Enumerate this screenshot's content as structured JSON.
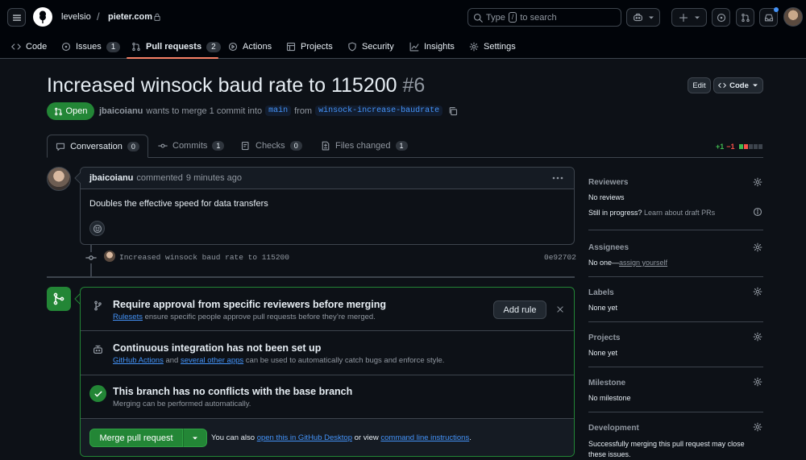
{
  "header": {
    "owner": "levelsio",
    "repo": "pieter.com",
    "search_prefix": "Type",
    "search_key": "/",
    "search_suffix": "to search"
  },
  "repo_tabs": [
    {
      "label": "Code",
      "count": ""
    },
    {
      "label": "Issues",
      "count": "1"
    },
    {
      "label": "Pull requests",
      "count": "2"
    },
    {
      "label": "Actions",
      "count": ""
    },
    {
      "label": "Projects",
      "count": ""
    },
    {
      "label": "Security",
      "count": ""
    },
    {
      "label": "Insights",
      "count": ""
    },
    {
      "label": "Settings",
      "count": ""
    }
  ],
  "pr": {
    "title": "Increased winsock baud rate to 115200",
    "number": "#6",
    "state": "Open",
    "author": "jbaicoianu",
    "merge_text": "wants to merge 1 commit into",
    "base_branch": "main",
    "from_text": "from",
    "head_branch": "winsock-increase-baudrate",
    "edit_label": "Edit",
    "code_label": "Code"
  },
  "pr_tabs": [
    {
      "label": "Conversation",
      "count": "0"
    },
    {
      "label": "Commits",
      "count": "1"
    },
    {
      "label": "Checks",
      "count": "0"
    },
    {
      "label": "Files changed",
      "count": "1"
    }
  ],
  "diffstat": {
    "added": "+1",
    "removed": "−1"
  },
  "comment": {
    "author": "jbaicoianu",
    "action": "commented",
    "time": "9 minutes ago",
    "body": "Doubles the effective speed for data transfers"
  },
  "commit": {
    "message": "Increased winsock baud rate to 115200",
    "sha": "0e92702"
  },
  "merge_box": {
    "approval_title": "Require approval from specific reviewers before merging",
    "approval_link": "Rulesets",
    "approval_sub": "ensure specific people approve pull requests before they’re merged.",
    "add_rule_label": "Add rule",
    "ci_title": "Continuous integration has not been set up",
    "ci_link1": "GitHub Actions",
    "ci_and": "and",
    "ci_link2": "several other apps",
    "ci_sub": "can be used to automatically catch bugs and enforce style.",
    "conflict_title": "This branch has no conflicts with the base branch",
    "conflict_sub": "Merging can be performed automatically.",
    "merge_button": "Merge pull request",
    "also_text": "You can also",
    "desktop_link": "open this in GitHub Desktop",
    "or_view": "or view",
    "cli_link": "command line instructions",
    "period": "."
  },
  "sidebar": {
    "reviewers_label": "Reviewers",
    "reviewers_value": "No reviews",
    "in_progress": "Still in progress?",
    "draft_link": "Learn about draft PRs",
    "assignees_label": "Assignees",
    "assignees_value": "No one—",
    "assign_link": "assign yourself",
    "labels_label": "Labels",
    "labels_value": "None yet",
    "projects_label": "Projects",
    "projects_value": "None yet",
    "milestone_label": "Milestone",
    "milestone_value": "No milestone",
    "development_label": "Development",
    "development_value": "Successfully merging this pull request may close these issues."
  },
  "colors": {
    "accent_green": "#238636",
    "link_blue": "#4493f8",
    "tab_underline": "#f78166",
    "bg": "#0d1117"
  }
}
